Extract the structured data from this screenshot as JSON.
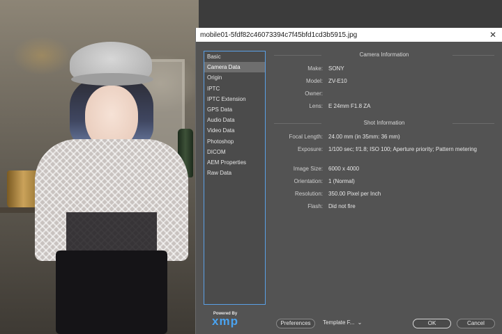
{
  "dialog": {
    "title": "mobile01-5fdf82c46073394c7f45bfd1cd3b5915.jpg",
    "close_glyph": "✕"
  },
  "sidebar": {
    "items": [
      {
        "label": "Basic",
        "active": false
      },
      {
        "label": "Camera Data",
        "active": true
      },
      {
        "label": "Origin",
        "active": false
      },
      {
        "label": "IPTC",
        "active": false
      },
      {
        "label": "IPTC Extension",
        "active": false
      },
      {
        "label": "GPS Data",
        "active": false
      },
      {
        "label": "Audio Data",
        "active": false
      },
      {
        "label": "Video Data",
        "active": false
      },
      {
        "label": "Photoshop",
        "active": false
      },
      {
        "label": "DICOM",
        "active": false
      },
      {
        "label": "AEM Properties",
        "active": false
      },
      {
        "label": "Raw Data",
        "active": false
      }
    ]
  },
  "camera_info": {
    "heading": "Camera Information",
    "make_label": "Make:",
    "make": "SONY",
    "model_label": "Model:",
    "model": "ZV-E10",
    "owner_label": "Owner:",
    "owner": "",
    "lens_label": "Lens:",
    "lens": "E 24mm F1.8 ZA"
  },
  "shot_info": {
    "heading": "Shot Information",
    "focal_label": "Focal Length:",
    "focal": "24.00 mm   (in 35mm: 36 mm)",
    "exposure_label": "Exposure:",
    "exposure": "1/100 sec;   f/1.8;   ISO 100;    Aperture priority;    Pattern metering",
    "size_label": "Image Size:",
    "size": "6000 x 4000",
    "orientation_label": "Orientation:",
    "orientation": "1 (Normal)",
    "resolution_label": "Resolution:",
    "resolution": "350.00 Pixel per Inch",
    "flash_label": "Flash:",
    "flash": "Did not fire"
  },
  "footer": {
    "powered_by": "Powered By",
    "xmp": "xmp",
    "preferences": "Preferences",
    "template": "Template F...",
    "ok": "OK",
    "cancel": "Cancel"
  },
  "colors": {
    "dialog_bg": "#535353",
    "sidebar_border": "#5aa0e6",
    "xmp_blue": "#4aa3f0"
  }
}
